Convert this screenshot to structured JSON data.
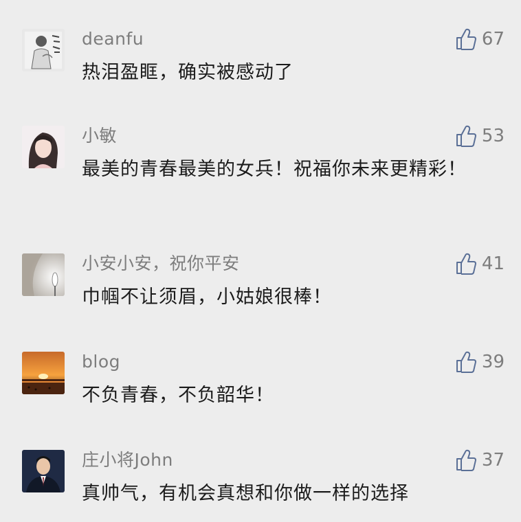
{
  "comments": [
    {
      "username": "deanfu",
      "text": "热泪盈眶，确实被感动了",
      "likes": "67",
      "avatar_icon": "sketch-figure-avatar"
    },
    {
      "username": "小敏",
      "text": "最美的青春最美的女兵！祝福你未来更精彩！",
      "likes": "53",
      "avatar_icon": "girl-portrait-avatar"
    },
    {
      "username": "小安小安，祝你平安",
      "text": "巾帼不让须眉，小姑娘很棒！",
      "likes": "41",
      "avatar_icon": "lamp-light-avatar"
    },
    {
      "username": "blog",
      "text": "不负青春，不负韶华！",
      "likes": "39",
      "avatar_icon": "sunset-avatar"
    },
    {
      "username": "庄小将John",
      "text": "真帅气，有机会真想和你做一样的选择",
      "likes": "37",
      "avatar_icon": "man-in-suit-avatar"
    }
  ],
  "colors": {
    "background": "#ededed",
    "username": "#7d7d7d",
    "text": "#1b1b1b",
    "like_icon": "#5a6f96"
  }
}
